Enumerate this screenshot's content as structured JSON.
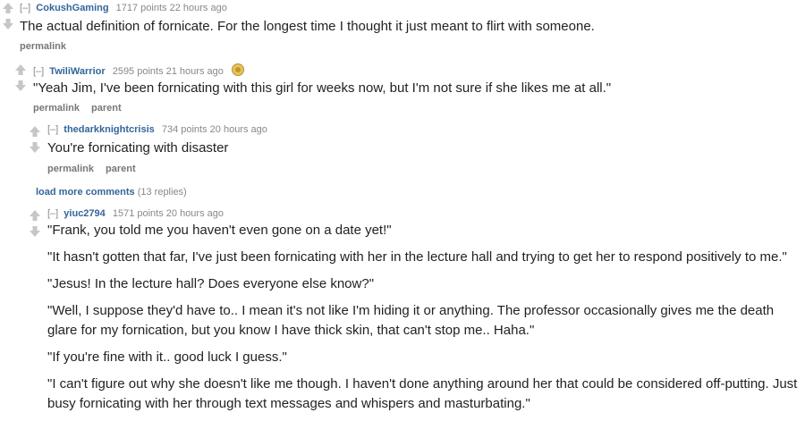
{
  "comments": [
    {
      "collapse": "[–]",
      "author": "CokushGaming",
      "meta": "1717 points 22 hours ago",
      "body": [
        "The actual definition of fornicate. For the longest time I thought it just meant to flirt with someone."
      ],
      "buttons": [
        "permalink"
      ]
    },
    {
      "collapse": "[–]",
      "author": "TwiliWarrior",
      "meta": "2595 points 21 hours ago",
      "body": [
        "\"Yeah Jim, I've been fornicating with this girl for weeks now, but I'm not sure if she likes me at all.\""
      ],
      "buttons": [
        "permalink",
        "parent"
      ]
    },
    {
      "collapse": "[–]",
      "author": "thedarkknightcrisis",
      "meta": "734 points 20 hours ago",
      "body": [
        "You're fornicating with disaster"
      ],
      "buttons": [
        "permalink",
        "parent"
      ]
    },
    {
      "collapse": "[–]",
      "author": "yiuc2794",
      "meta": "1571 points 20 hours ago",
      "body": [
        "\"Frank, you told me you haven't even gone on a date yet!\"",
        "\"It hasn't gotten that far, I've just been fornicating with her in the lecture hall and trying to get her to respond positively to me.\"",
        "\"Jesus! In the lecture hall? Does everyone else know?\"",
        "\"Well, I suppose they'd have to.. I mean it's not like I'm hiding it or anything. The professor occasionally gives me the death glare for my fornication, but you know I have thick skin, that can't stop me.. Haha.\"",
        "\"If you're fine with it.. good luck I guess.\"",
        "\"I can't figure out why she doesn't like me though. I haven't done anything around her that could be considered off-putting. Just busy fornicating with her through text messages and whispers and masturbating.\""
      ],
      "buttons": []
    }
  ],
  "load_more": {
    "label": "load more comments",
    "count": "(13 replies)"
  },
  "icons": {
    "upvote": "upvote-arrow-icon",
    "downvote": "downvote-arrow-icon",
    "flair": "gold-award-icon"
  },
  "colors": {
    "author": "#336699",
    "meta": "#888888",
    "arrow": "#c6c6c6",
    "text": "#222222"
  }
}
